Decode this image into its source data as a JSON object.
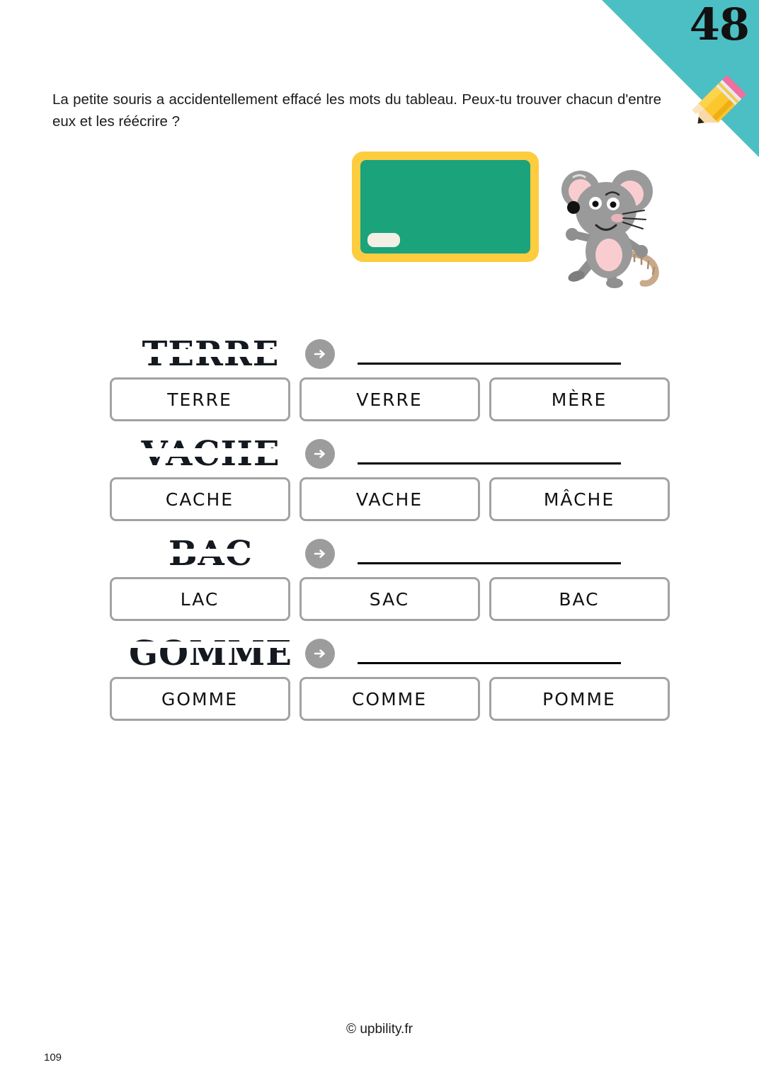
{
  "header": {
    "sheet_number": "48",
    "pencil_icon": "pencil-icon",
    "corner_color": "#4CBFC4"
  },
  "intro": {
    "text": "La petite souris a accidentellement effacé les mots du tableau. Peux-tu trouver chacun d'entre eux et les réécrire ?"
  },
  "illustration": {
    "chalkboard_icon": "chalkboard-icon",
    "mouse_icon": "mouse-icon",
    "board_color": "#1BA37C",
    "frame_color": "#FDCC3F",
    "eraser_color": "#F2F0E4",
    "mouse_body_color": "#9A9A9A",
    "mouse_pink_color": "#F9CDD0"
  },
  "exercises": [
    {
      "erased_word": "TERRE",
      "arrow_icon": "arrow-right-icon",
      "choices": [
        "TERRE",
        "VERRE",
        "MÈRE"
      ]
    },
    {
      "erased_word": "VACHE",
      "arrow_icon": "arrow-right-icon",
      "choices": [
        "CACHE",
        "VACHE",
        "MÂCHE"
      ]
    },
    {
      "erased_word": "BAC",
      "arrow_icon": "arrow-right-icon",
      "choices": [
        "LAC",
        "SAC",
        "BAC"
      ]
    },
    {
      "erased_word": "GOMME",
      "arrow_icon": "arrow-right-icon",
      "choices": [
        "GOMME",
        "COMME",
        "POMME"
      ]
    }
  ],
  "footer": {
    "credit": "© upbility.fr",
    "page_number": "109"
  }
}
